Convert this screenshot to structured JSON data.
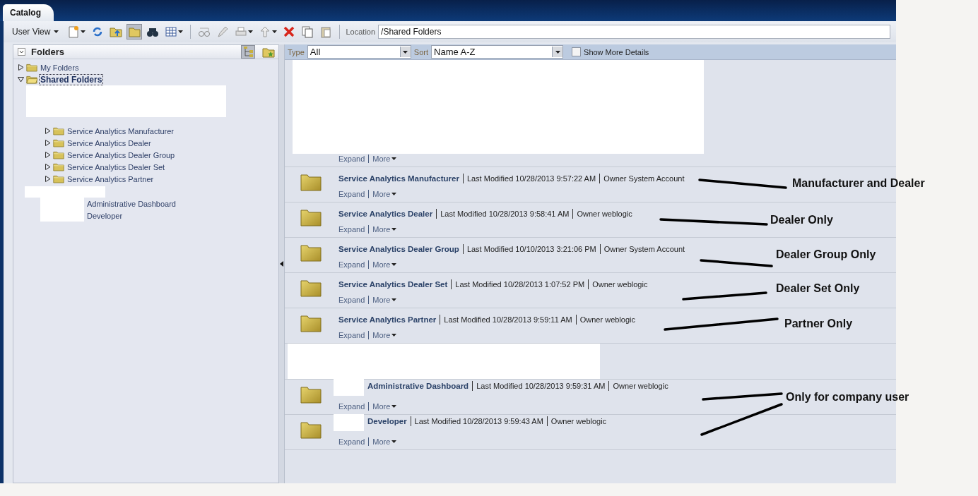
{
  "tab": {
    "label": "Catalog",
    "selected": true
  },
  "toolbar": {
    "view_menu": "User View",
    "location_label": "Location",
    "location": "/Shared Folders"
  },
  "folders_panel": {
    "title": "Folders",
    "tree": [
      {
        "label": "My Folders",
        "expanded": false,
        "selected": false
      },
      {
        "label": "Shared Folders",
        "expanded": true,
        "selected": true,
        "children": [
          {
            "label": "Service Analytics Manufacturer",
            "kind": "folder",
            "expanded": false
          },
          {
            "label": "Service Analytics Dealer",
            "kind": "folder",
            "expanded": false
          },
          {
            "label": "Service Analytics Dealer Group",
            "kind": "folder",
            "expanded": false
          },
          {
            "label": "Service Analytics Dealer Set",
            "kind": "folder",
            "expanded": false
          },
          {
            "label": "Service Analytics Partner",
            "kind": "folder",
            "expanded": false
          },
          {
            "label": "Administrative Dashboard",
            "kind": "masked"
          },
          {
            "label": "Developer",
            "kind": "masked"
          }
        ]
      }
    ]
  },
  "filter_bar": {
    "type_label": "Type",
    "type_value": "All",
    "sort_label": "Sort",
    "sort_value": "Name A-Z",
    "show_more_details": {
      "label": "Show More Details",
      "checked": false
    }
  },
  "items": [
    {
      "kind": "partial",
      "expand": "Expand",
      "more": "More"
    },
    {
      "kind": "folder",
      "name": "Service Analytics Manufacturer",
      "modified": "Last Modified 10/28/2013 9:57:22 AM",
      "owner": "Owner System Account",
      "expand": "Expand",
      "more": "More"
    },
    {
      "kind": "folder",
      "name": "Service Analytics Dealer",
      "modified": "Last Modified 10/28/2013 9:58:41 AM",
      "owner": "Owner weblogic",
      "expand": "Expand",
      "more": "More"
    },
    {
      "kind": "folder",
      "name": "Service Analytics Dealer Group",
      "modified": "Last Modified 10/10/2013 3:21:06 PM",
      "owner": "Owner System Account",
      "expand": "Expand",
      "more": "More"
    },
    {
      "kind": "folder",
      "name": "Service Analytics Dealer Set",
      "modified": "Last Modified 10/28/2013 1:07:52 PM",
      "owner": "Owner weblogic",
      "expand": "Expand",
      "more": "More"
    },
    {
      "kind": "folder",
      "name": "Service Analytics Partner",
      "modified": "Last Modified 10/28/2013 9:59:11 AM",
      "owner": "Owner weblogic",
      "expand": "Expand",
      "more": "More"
    },
    {
      "kind": "blank"
    },
    {
      "kind": "masked",
      "name": "Administrative Dashboard",
      "modified": "Last Modified 10/28/2013 9:59:31 AM",
      "owner": "Owner weblogic",
      "expand": "Expand",
      "more": "More"
    },
    {
      "kind": "masked",
      "name": "Developer",
      "modified": "Last Modified 10/28/2013 9:59:43 AM",
      "owner": "Owner weblogic",
      "expand": "Expand",
      "more": "More"
    }
  ],
  "annotations": [
    {
      "text": "Manufacturer and Dealer"
    },
    {
      "text": "Dealer Only"
    },
    {
      "text": "Dealer Group Only"
    },
    {
      "text": "Dealer Set Only"
    },
    {
      "text": "Partner Only"
    },
    {
      "text": "Only for company user"
    }
  ]
}
